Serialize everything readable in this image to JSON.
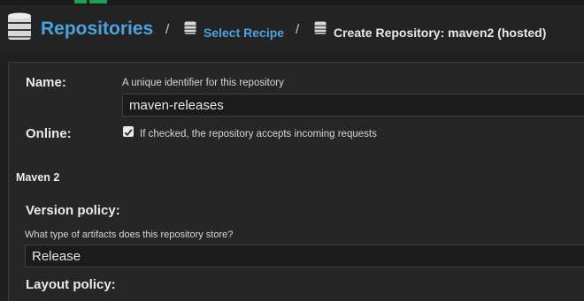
{
  "header": {
    "title": "Repositories",
    "separator": "/",
    "link": "Select Recipe",
    "current": "Create Repository: maven2 (hosted)"
  },
  "form": {
    "name_label": "Name:",
    "name_help": "A unique identifier for this repository",
    "name_value": "maven-releases",
    "online_label": "Online:",
    "online_checked": true,
    "online_help": "If checked, the repository accepts incoming requests",
    "section_title": "Maven 2",
    "version_label": "Version policy:",
    "version_help": "What type of artifacts does this repository store?",
    "version_value": "Release",
    "layout_label": "Layout policy:"
  },
  "colors": {
    "accent": "#4aa3df",
    "background": "#1f1f1f",
    "panel": "#262626"
  },
  "icons": {
    "repo": "database-icon",
    "checkbox": "checkmark-icon"
  }
}
